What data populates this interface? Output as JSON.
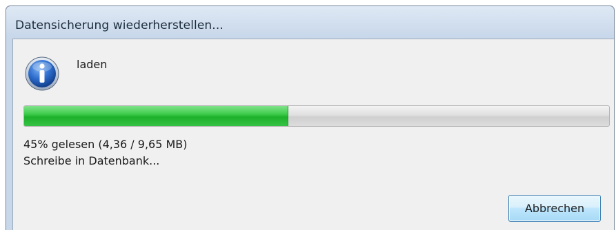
{
  "window": {
    "title": "Datensicherung wiederherstellen..."
  },
  "dialog": {
    "icon": "info-icon",
    "main_label": "laden",
    "progress": {
      "percent": 45
    },
    "status_line_1": "45% gelesen (4,36 / 9,65 MB)",
    "status_line_2": "Schreibe in Datenbank...",
    "cancel_label": "Abbrechen"
  },
  "colors": {
    "progress_fill": "#1db12b",
    "button_border": "#3c7fb1",
    "titlebar": "#d3e0ef"
  }
}
